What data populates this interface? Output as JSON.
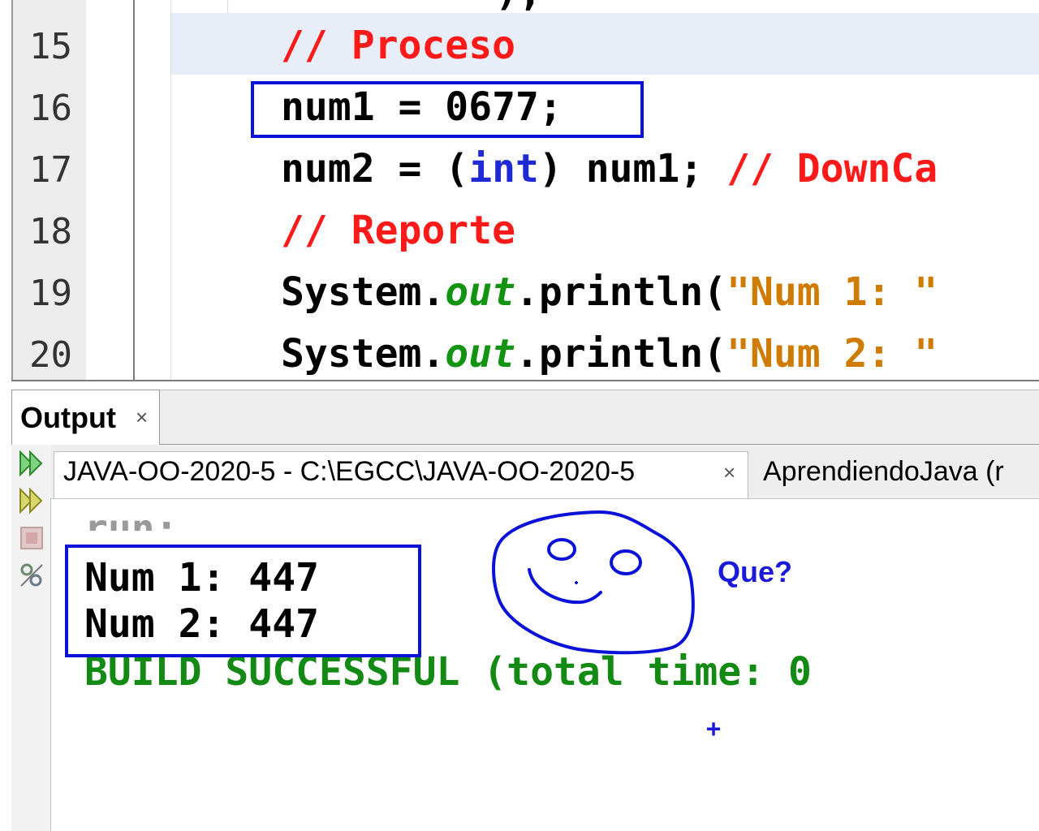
{
  "editor": {
    "top_fragment": ");",
    "lines": [
      {
        "number": "15",
        "tokens": [
          {
            "t": "// Proceso",
            "c": "cm"
          }
        ]
      },
      {
        "number": "16",
        "tokens": [
          {
            "t": "num1 = 0677;",
            "c": ""
          }
        ]
      },
      {
        "number": "17",
        "tokens": [
          {
            "t": "num2 = (",
            "c": ""
          },
          {
            "t": "int",
            "c": "kw"
          },
          {
            "t": ") num1; ",
            "c": ""
          },
          {
            "t": "// DownCa",
            "c": "cm"
          }
        ]
      },
      {
        "number": "18",
        "tokens": [
          {
            "t": "// Reporte",
            "c": "cm"
          }
        ]
      },
      {
        "number": "19",
        "tokens": [
          {
            "t": "System.",
            "c": ""
          },
          {
            "t": "out",
            "c": "fld"
          },
          {
            "t": ".println(",
            "c": ""
          },
          {
            "t": "\"Num 1: \"",
            "c": "str"
          }
        ]
      },
      {
        "number": "20",
        "tokens": [
          {
            "t": "System.",
            "c": ""
          },
          {
            "t": "out",
            "c": "fld"
          },
          {
            "t": ".println(",
            "c": ""
          },
          {
            "t": "\"Num 2: \"",
            "c": "str"
          }
        ]
      }
    ]
  },
  "output": {
    "tab_label": "Output",
    "tab_close": "×",
    "run_tabs": [
      {
        "label": "JAVA-OO-2020-5 - C:\\EGCC\\JAVA-OO-2020-5",
        "close": "×"
      },
      {
        "label": "AprendiendoJava (r"
      }
    ],
    "toolbar_icons": [
      "rerun-icon",
      "rerun-with-options-icon",
      "stop-icon",
      "settings-icon"
    ],
    "console": {
      "run": "run:",
      "line1": "Num 1: 447",
      "line2": "Num 2: 447",
      "build": "BUILD SUCCESSFUL (total time: 0"
    }
  },
  "annotation": {
    "text": "Que?",
    "cursor": "+"
  },
  "colors": {
    "comment": "#ff1a1a",
    "keyword": "#1f2ad6",
    "field": "#129412",
    "string": "#ce7b00",
    "build_success": "#138a13",
    "annotation_blue": "#0a12d8"
  }
}
